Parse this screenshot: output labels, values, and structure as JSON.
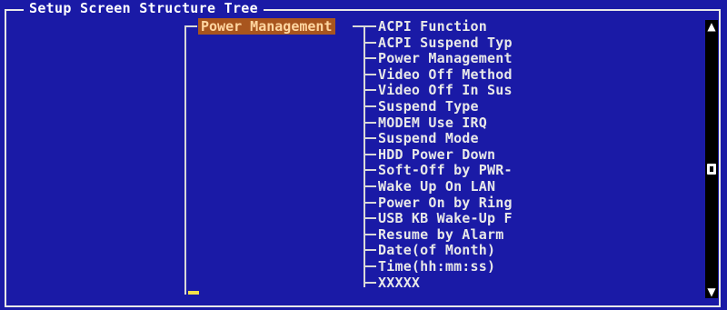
{
  "frame": {
    "title": "Setup Screen Structure Tree"
  },
  "tree": {
    "root": "Power Management",
    "items": [
      {
        "label": "ACPI Function"
      },
      {
        "label": "ACPI Suspend Typ"
      },
      {
        "label": "Power Management"
      },
      {
        "label": "Video Off Method"
      },
      {
        "label": "Video Off In Sus"
      },
      {
        "label": "Suspend Type"
      },
      {
        "label": "MODEM Use IRQ"
      },
      {
        "label": "Suspend Mode"
      },
      {
        "label": "HDD Power Down"
      },
      {
        "label": "Soft-Off by PWR-"
      },
      {
        "label": "Wake Up On LAN"
      },
      {
        "label": "Power On by Ring"
      },
      {
        "label": "USB KB Wake-Up F"
      },
      {
        "label": "Resume by Alarm"
      },
      {
        "label": " Date(of Month)"
      },
      {
        "label": " Time(hh:mm:ss)"
      },
      {
        "label": "XXXXX"
      }
    ]
  },
  "scrollbar": {
    "up_icon": "up-arrow-icon",
    "down_icon": "down-arrow-icon",
    "up_glyph": "▲",
    "down_glyph": "▼"
  },
  "colors": {
    "background": "#1a1aa6",
    "highlight": "#a8551e",
    "text": "#e8e8e8",
    "cursor": "#f5e04a"
  }
}
